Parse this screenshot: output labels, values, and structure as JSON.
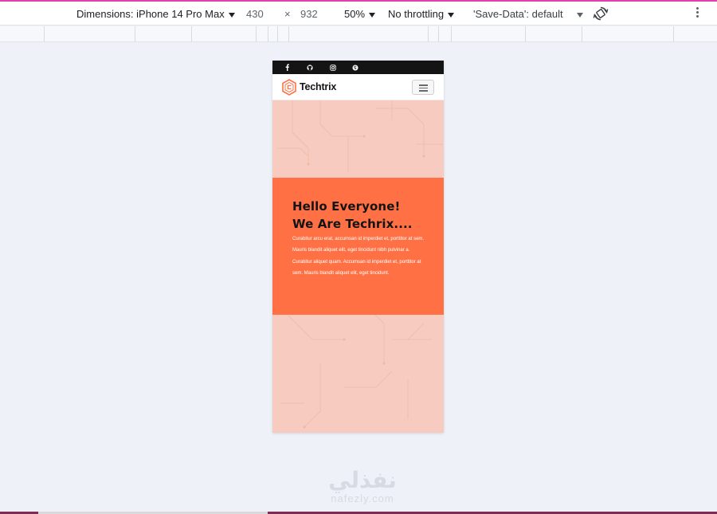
{
  "devtools": {
    "dimensions_label": "Dimensions: iPhone 14 Pro Max",
    "width": "430",
    "times": "×",
    "height": "932",
    "zoom": "50%",
    "throttling": "No throttling",
    "save_data": "'Save-Data': default",
    "icons": {
      "rotate": "rotate-icon",
      "more": "kebab-menu-icon"
    }
  },
  "site": {
    "social": [
      "facebook-icon",
      "github-icon",
      "instagram-icon",
      "skype-icon"
    ],
    "brand": "Techtrix",
    "hero": {
      "title_line1": "Hello Everyone!",
      "title_line2": "We Are Techrix....",
      "body": "Curabitur arcu erat, accumsan id imperdiet et, porttitor at sem. Mauris blandit aliquet elit, eget tincidunt nibh pulvinar a. Curabitur aliquet quam. Accumsan id imperdiet et, porttitor at sem. Mauris blandit aliquet elit, eget tincidunt."
    },
    "colors": {
      "accent": "#ff7144",
      "hero_bg": "#f7cbbf",
      "social_bar": "#141414"
    }
  },
  "watermark": {
    "arabic": "نفذلي",
    "latin": "nafezly.com"
  }
}
